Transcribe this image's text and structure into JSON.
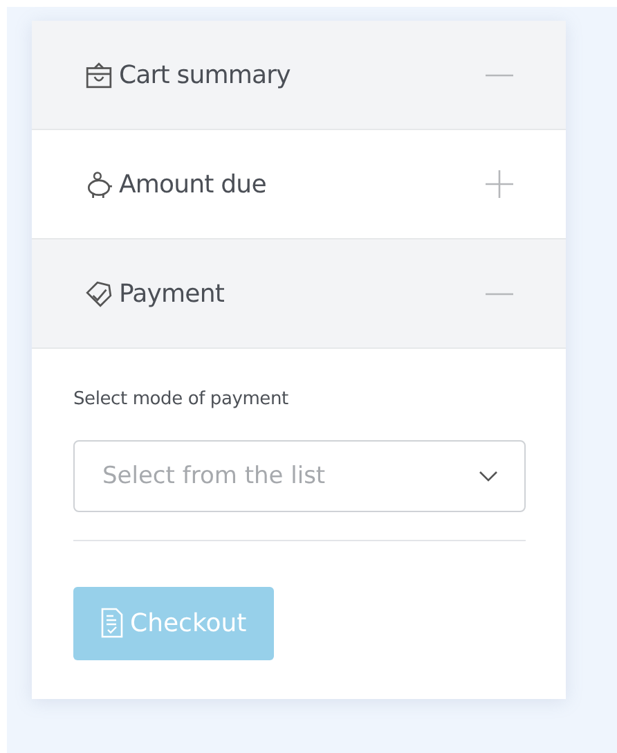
{
  "sections": [
    {
      "title": "Cart summary",
      "expanded": true
    },
    {
      "title": "Amount due",
      "expanded": false
    },
    {
      "title": "Payment",
      "expanded": true,
      "body": {
        "label": "Select mode of payment",
        "select": {
          "placeholder": "Select from the list"
        },
        "button": {
          "label": "Checkout",
          "disabled": true
        }
      }
    }
  ]
}
